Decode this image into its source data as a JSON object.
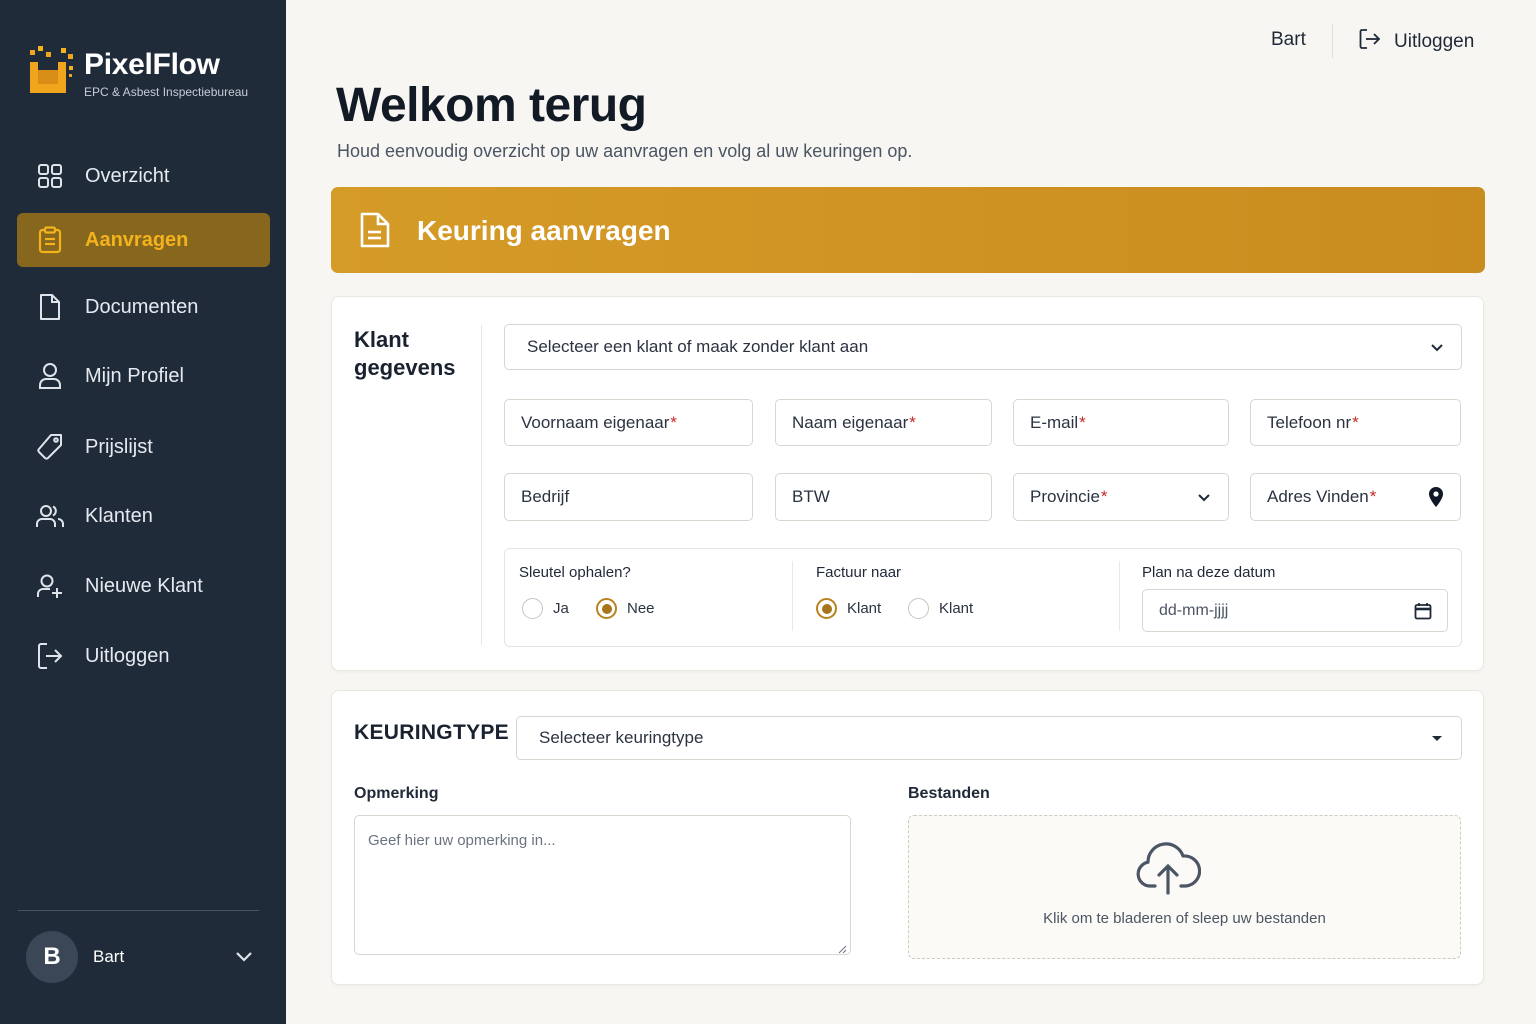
{
  "brand": {
    "name": "PixelFlow",
    "tagline": "EPC & Asbest Inspectiebureau"
  },
  "sidebar": {
    "items": [
      {
        "label": "Overzicht",
        "icon": "grid-icon",
        "active": false
      },
      {
        "label": "Aanvragen",
        "icon": "clipboard-icon",
        "active": true
      },
      {
        "label": "Documenten",
        "icon": "document-icon",
        "active": false
      },
      {
        "label": "Mijn Profiel",
        "icon": "user-icon",
        "active": false
      },
      {
        "label": "Prijslijst",
        "icon": "tag-icon",
        "active": false
      },
      {
        "label": "Klanten",
        "icon": "users-icon",
        "active": false
      },
      {
        "label": "Nieuwe Klant",
        "icon": "user-plus-icon",
        "active": false
      },
      {
        "label": "Uitloggen",
        "icon": "logout-icon",
        "active": false
      }
    ],
    "user": {
      "initial": "B",
      "name": "Bart"
    }
  },
  "topbar": {
    "user_name": "Bart",
    "logout_label": "Uitloggen"
  },
  "header": {
    "title": "Welkom terug",
    "subtitle": "Houd eenvoudig overzicht op uw aanvragen en volg al uw keuringen op."
  },
  "banner": {
    "title": "Keuring aanvragen"
  },
  "klant": {
    "section_title": "Klant gegevens",
    "client_select": "Selecteer een klant of maak zonder klant aan",
    "fields": {
      "voornaam": "Voornaam eigenaar",
      "naam": "Naam eigenaar",
      "email": "E-mail",
      "telefoon": "Telefoon nr",
      "bedrijf": "Bedrijf",
      "btw": "BTW",
      "provincie": "Provincie",
      "adres": "Adres Vinden"
    },
    "required_mark": "*",
    "sleutel": {
      "label": "Sleutel ophalen?",
      "options": [
        "Ja",
        "Nee"
      ],
      "selected": "Nee"
    },
    "factuur": {
      "label": "Factuur naar",
      "options": [
        "Klant",
        "Klant"
      ],
      "selected_index": 0
    },
    "plan": {
      "label": "Plan na deze datum",
      "placeholder": "dd-mm-jjjj"
    }
  },
  "keuring": {
    "section_title": "KEURINGTYPE",
    "type_select": "Selecteer keuringtype",
    "opmerking_label": "Opmerking",
    "opmerking_placeholder": "Geef hier uw opmerking in...",
    "bestanden_label": "Bestanden",
    "dropzone_text": "Klik om te bladeren of  sleep uw bestanden"
  },
  "colors": {
    "sidebar_bg": "#202b3a",
    "accent": "#d59b27",
    "active_bg": "#87661d",
    "active_text": "#f4b31d",
    "required": "#c62828"
  }
}
